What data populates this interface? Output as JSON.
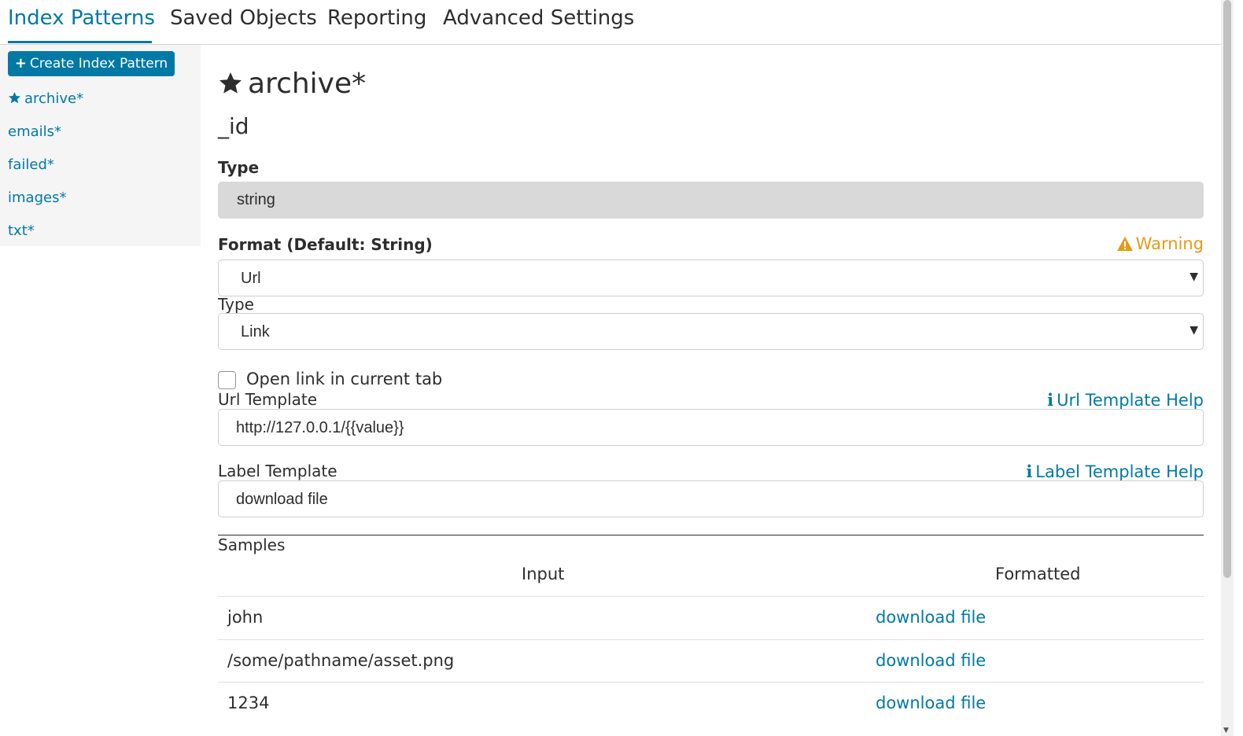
{
  "topnav": {
    "tabs": [
      {
        "label": "Index Patterns"
      },
      {
        "label": "Saved Objects"
      },
      {
        "label": "Reporting"
      },
      {
        "label": "Advanced Settings"
      }
    ]
  },
  "sidebar": {
    "create_button": "Create Index Pattern",
    "items": [
      {
        "label": "archive*",
        "icon": "star-icon",
        "default": true
      },
      {
        "label": "emails*"
      },
      {
        "label": "failed*"
      },
      {
        "label": "images*"
      },
      {
        "label": "txt*"
      }
    ]
  },
  "main": {
    "title": "archive*",
    "field_name": "_id",
    "type_label": "Type",
    "type_value": "string",
    "format_label": "Format (Default: String)",
    "warning": "Warning",
    "format_value": "Url",
    "link_type_label": "Type",
    "link_type_value": "Link",
    "open_current_tab_label": "Open link in current tab",
    "open_current_tab_checked": false,
    "url_template_label": "Url Template",
    "url_template_help": "Url Template Help",
    "url_template_value": "http://127.0.0.1/{{value}}",
    "label_template_label": "Label Template",
    "label_template_help": "Label Template Help",
    "label_template_value": "download file"
  },
  "samples": {
    "title": "Samples",
    "columns": [
      "Input",
      "Formatted"
    ],
    "rows": [
      {
        "input": "john",
        "formatted": "download file"
      },
      {
        "input": "/some/pathname/asset.png",
        "formatted": "download file"
      },
      {
        "input": "1234",
        "formatted": "download file"
      }
    ]
  },
  "colors": {
    "accent": "#0079a5",
    "warning": "#e39b16",
    "readonly_bg": "#d9d9d9"
  }
}
